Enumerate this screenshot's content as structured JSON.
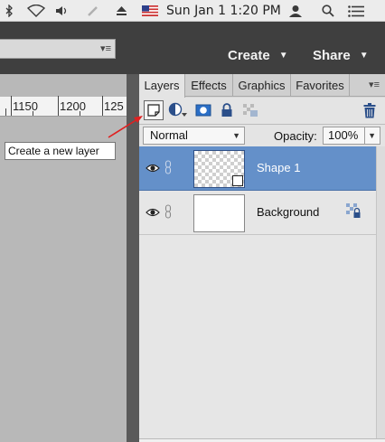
{
  "menubar": {
    "clock": "Sun Jan 1  1:20 PM",
    "icons": [
      "bluetooth-icon",
      "wifi-icon",
      "volume-icon",
      "pen-icon",
      "eject-icon",
      "us-flag-icon",
      "user-icon",
      "search-icon",
      "list-icon"
    ]
  },
  "appbar": {
    "create_label": "Create",
    "share_label": "Share"
  },
  "ruler": {
    "ticks": [
      "1150",
      "1200",
      "125"
    ]
  },
  "panel": {
    "tabs": [
      {
        "label": "Layers"
      },
      {
        "label": "Effects"
      },
      {
        "label": "Graphics"
      },
      {
        "label": "Favorites"
      }
    ],
    "blend_mode": "Normal",
    "opacity_label": "Opacity:",
    "opacity_value": "100%",
    "layers": [
      {
        "name": "Shape 1",
        "selected": true
      },
      {
        "name": "Background",
        "selected": false
      }
    ]
  },
  "tooltip": {
    "text": "Create a new layer"
  },
  "colors": {
    "selection": "#6490c9",
    "arrow": "#e02020",
    "appbar": "#3f3f3f"
  }
}
